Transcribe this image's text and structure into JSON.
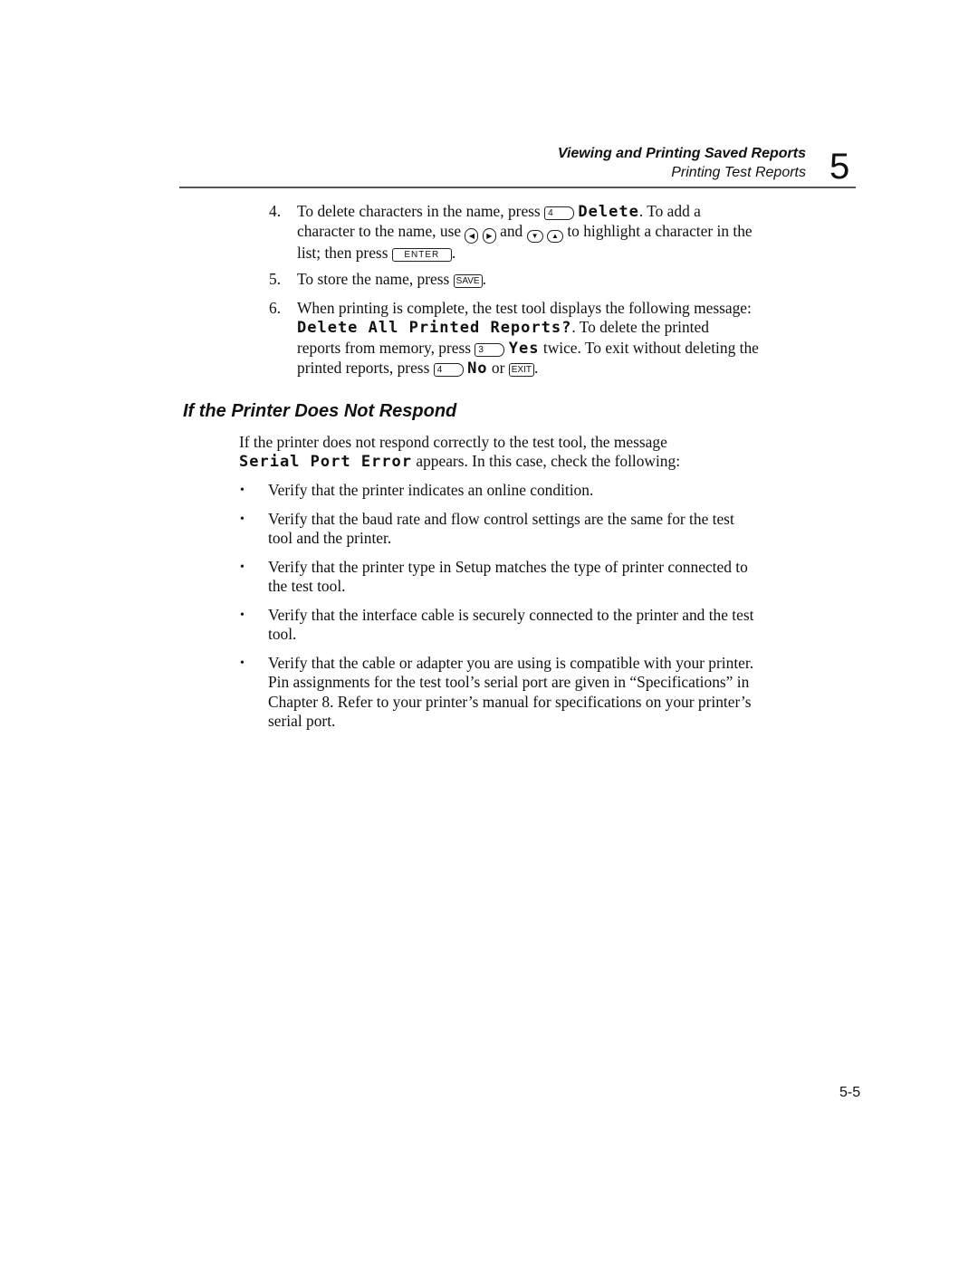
{
  "header": {
    "chapter_title": "Viewing and Printing Saved Reports",
    "section_title": "Printing Test Reports",
    "chapter_number": "5"
  },
  "steps": [
    {
      "number": "4.",
      "t1": "To delete characters in the name, press",
      "key1": "4",
      "lcd1": "Delete",
      "t2": ". To add a",
      "t3": "character to the name, use",
      "left_icon": "◀",
      "right_icon": "▶",
      "t4": "and",
      "down_icon": "▼",
      "up_icon": "▲",
      "t5": "to highlight a character in the",
      "t6": "list; then press",
      "key2": "ENTER",
      "t7": "."
    },
    {
      "number": "5.",
      "t1": "To store the name, press",
      "key1": "SAVE",
      "t2": "."
    },
    {
      "number": "6.",
      "t1": "When printing is complete, the test tool displays the following message:",
      "lcd1": "Delete All Printed Reports?",
      "t2": ". To delete the printed",
      "t3": "reports from memory, press",
      "key1": "3",
      "lcd2": "Yes",
      "t4": "twice. To exit without deleting the",
      "t5": "printed reports, press",
      "key2": "4",
      "lcd3": "No",
      "t6": "or",
      "key3": "EXIT",
      "t7": "."
    }
  ],
  "section": {
    "heading": "If the Printer Does Not Respond",
    "intro1": "If the printer does not respond correctly to the test tool, the message",
    "intro_lcd": "Serial Port Error",
    "intro2": "appears. In this case, check the following:"
  },
  "bullets": [
    {
      "lines": [
        "Verify that the printer indicates an online condition."
      ]
    },
    {
      "lines": [
        "Verify that the baud rate and flow control settings are the same for the test",
        "tool and the printer."
      ]
    },
    {
      "lines": [
        "Verify that the printer type in Setup matches the type of printer connected to",
        "the test tool."
      ]
    },
    {
      "lines": [
        "Verify that the interface cable is securely connected to the printer and the test",
        "tool."
      ]
    },
    {
      "lines": [
        "Verify that the cable or adapter you are using is compatible with your printer.",
        "Pin assignments for the test tool’s serial port are given in “Specifications” in",
        "Chapter 8. Refer to your printer’s manual for specifications on your printer’s",
        "serial port."
      ]
    }
  ],
  "footer": {
    "page_number": "5-5"
  },
  "bullet_glyph": "•"
}
